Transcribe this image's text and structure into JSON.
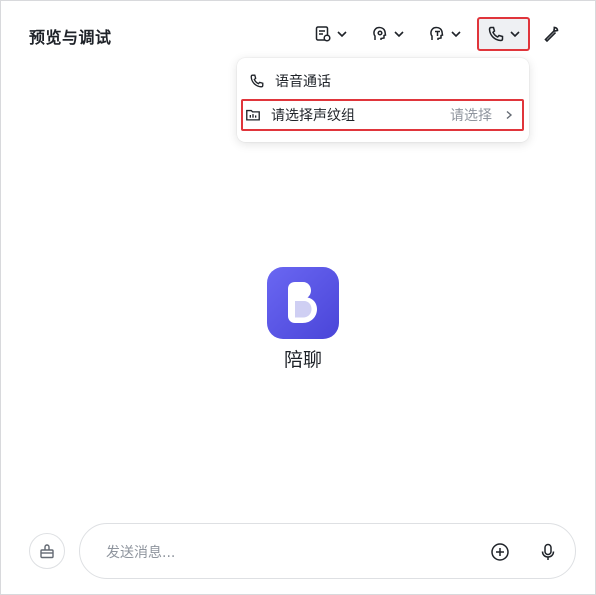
{
  "header": {
    "title": "预览与调试"
  },
  "toolbar": {
    "buttons": [
      {
        "icon": "doc-settings-icon"
      },
      {
        "icon": "persona-head-icon"
      },
      {
        "icon": "text-style-head-icon"
      },
      {
        "icon": "phone-icon"
      },
      {
        "icon": "wrench-icon"
      }
    ]
  },
  "dropdown": {
    "items": [
      {
        "label": "语音通话"
      },
      {
        "label": "请选择声纹组",
        "value": "请选择"
      }
    ]
  },
  "bot": {
    "name": "陪聊"
  },
  "composer": {
    "placeholder": "发送消息..."
  },
  "colors": {
    "accent": "#5653e6",
    "highlight": "#e0353b"
  }
}
